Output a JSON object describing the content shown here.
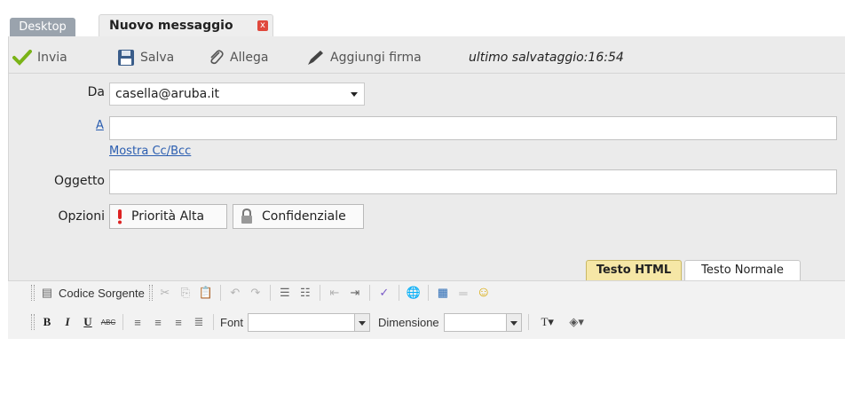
{
  "tabs": {
    "desktop": "Desktop",
    "active": "Nuovo messaggio",
    "close": "x"
  },
  "toolbar": {
    "send": "Invia",
    "save": "Salva",
    "attach": "Allega",
    "signature": "Aggiungi firma",
    "last_saved": "ultimo salvataggio:16:54"
  },
  "form": {
    "from_label": "Da",
    "from_value": "casella@aruba.it",
    "to_label": "A",
    "to_value": "",
    "show_cc": "Mostra Cc/Bcc",
    "subject_label": "Oggetto",
    "subject_value": "",
    "options_label": "Opzioni",
    "priority_button": "Priorità Alta",
    "confidential_button": "Confidenziale"
  },
  "mode_tabs": {
    "html": "Testo HTML",
    "plain": "Testo Normale",
    "active": "html"
  },
  "editor": {
    "source_button": "Codice Sorgente",
    "font_label": "Font",
    "font_value": "",
    "size_label": "Dimensione",
    "size_value": ""
  },
  "icons": {
    "send": "checkmark-icon",
    "save": "floppy-disk-icon",
    "attach": "paperclip-icon",
    "signature": "pen-icon",
    "priority": "exclamation-icon",
    "confidential": "lock-icon"
  },
  "colors": {
    "accent": "#7ab317",
    "close": "#e0483c",
    "link": "#2a5db0"
  }
}
